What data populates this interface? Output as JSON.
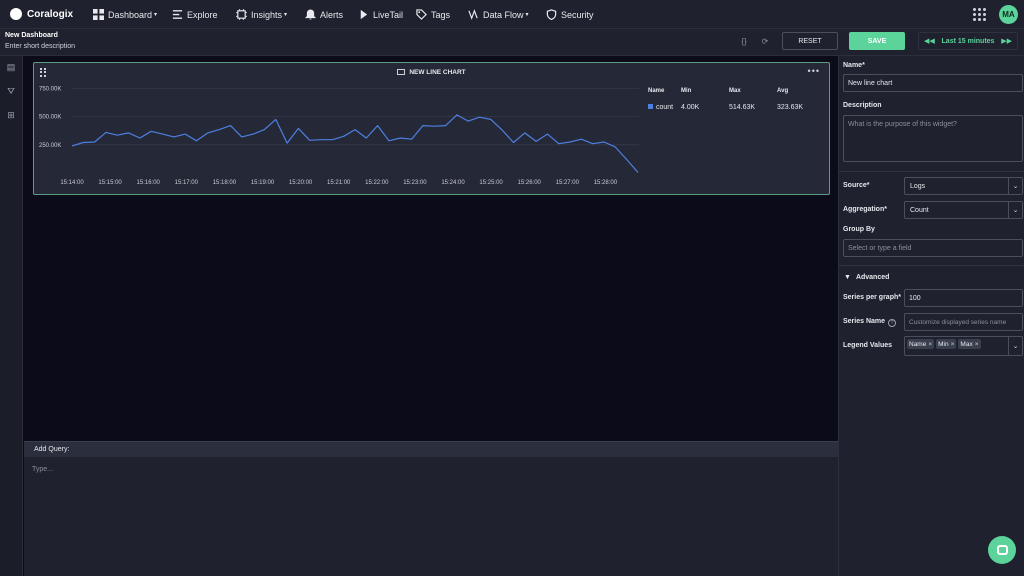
{
  "app": {
    "brand": "Coralogix",
    "accent": "#5bd39a",
    "series_color": "#4d7fe0"
  },
  "nav": {
    "items": [
      {
        "label": "Dashboard",
        "icon": "dashboard-icon",
        "dropdown": true
      },
      {
        "label": "Explore",
        "icon": "explore-icon"
      },
      {
        "label": "Insights",
        "icon": "insights-icon",
        "dropdown": true
      },
      {
        "label": "Alerts",
        "icon": "bell-icon"
      },
      {
        "label": "LiveTail",
        "icon": "play-icon"
      },
      {
        "label": "Tags",
        "icon": "tag-icon"
      },
      {
        "label": "Data Flow",
        "icon": "data-flow-icon",
        "dropdown": true
      },
      {
        "label": "Security",
        "icon": "shield-icon"
      }
    ],
    "user_initials": "MA"
  },
  "dashboard": {
    "title": "New Dashboard",
    "description": "Enter short description",
    "reset_label": "RESET",
    "save_label": "SAVE",
    "time_range": "Last 15 minutes"
  },
  "widget": {
    "title": "NEW LINE CHART",
    "legend": {
      "headers": [
        "Name",
        "Min",
        "Max",
        "Avg"
      ],
      "rows": [
        {
          "name": "count",
          "min": "4.00K",
          "max": "514.63K",
          "avg": "323.63K"
        }
      ]
    }
  },
  "chart_data": {
    "type": "line",
    "x": [
      "15:14:00",
      "15:14:20",
      "15:14:40",
      "15:15:00",
      "15:15:20",
      "15:15:40",
      "15:16:00",
      "15:16:20",
      "15:16:40",
      "15:17:00",
      "15:17:20",
      "15:17:40",
      "15:18:00",
      "15:18:20",
      "15:18:40",
      "15:19:00",
      "15:19:20",
      "15:19:40",
      "15:20:00",
      "15:20:20",
      "15:20:40",
      "15:21:00",
      "15:21:20",
      "15:21:40",
      "15:22:00",
      "15:22:20",
      "15:22:40",
      "15:23:00",
      "15:23:20",
      "15:23:40",
      "15:24:00",
      "15:24:20",
      "15:24:40",
      "15:25:00",
      "15:25:20",
      "15:25:40",
      "15:26:00",
      "15:26:20",
      "15:26:40",
      "15:27:00",
      "15:27:20",
      "15:27:40",
      "15:28:00",
      "15:28:20",
      "15:28:40"
    ],
    "x_ticks": [
      "15:14:00",
      "15:15:00",
      "15:16:00",
      "15:17:00",
      "15:18:00",
      "15:19:00",
      "15:20:00",
      "15:21:00",
      "15:22:00",
      "15:23:00",
      "15:24:00",
      "15:25:00",
      "15:26:00",
      "15:27:00",
      "15:28:00"
    ],
    "series": [
      {
        "name": "count",
        "values": [
          240000,
          270000,
          275000,
          360000,
          335000,
          355000,
          310000,
          370000,
          345000,
          320000,
          345000,
          285000,
          355000,
          385000,
          420000,
          320000,
          345000,
          385000,
          475000,
          265000,
          395000,
          290000,
          295000,
          295000,
          325000,
          385000,
          310000,
          420000,
          285000,
          310000,
          300000,
          420000,
          415000,
          420000,
          514630,
          460000,
          495000,
          475000,
          380000,
          270000,
          355000,
          280000,
          345000,
          260000,
          275000,
          300000,
          260000,
          275000,
          230000,
          120000,
          4000
        ]
      }
    ],
    "y_ticks": [
      "250.00K",
      "500.00K",
      "750.00K"
    ],
    "ylim": [
      0,
      780000
    ],
    "grid": true,
    "legend_position": "right"
  },
  "panel": {
    "name_label": "Name*",
    "name_value": "New line chart",
    "description_label": "Description",
    "description_placeholder": "What is the purpose of this widget?",
    "source_label": "Source*",
    "source_value": "Logs",
    "aggregation_label": "Aggregation*",
    "aggregation_value": "Count",
    "group_by_label": "Group By",
    "group_by_placeholder": "Select or type a field",
    "advanced_label": "Advanced",
    "series_per_graph_label": "Series per graph*",
    "series_per_graph_value": "100",
    "series_name_label": "Series Name",
    "series_name_placeholder": "Customize displayed series name",
    "legend_values_label": "Legend Values",
    "legend_values_tags": [
      "Name",
      "Min",
      "Max"
    ]
  },
  "query": {
    "label": "Add Query:",
    "placeholder": "Type..."
  }
}
